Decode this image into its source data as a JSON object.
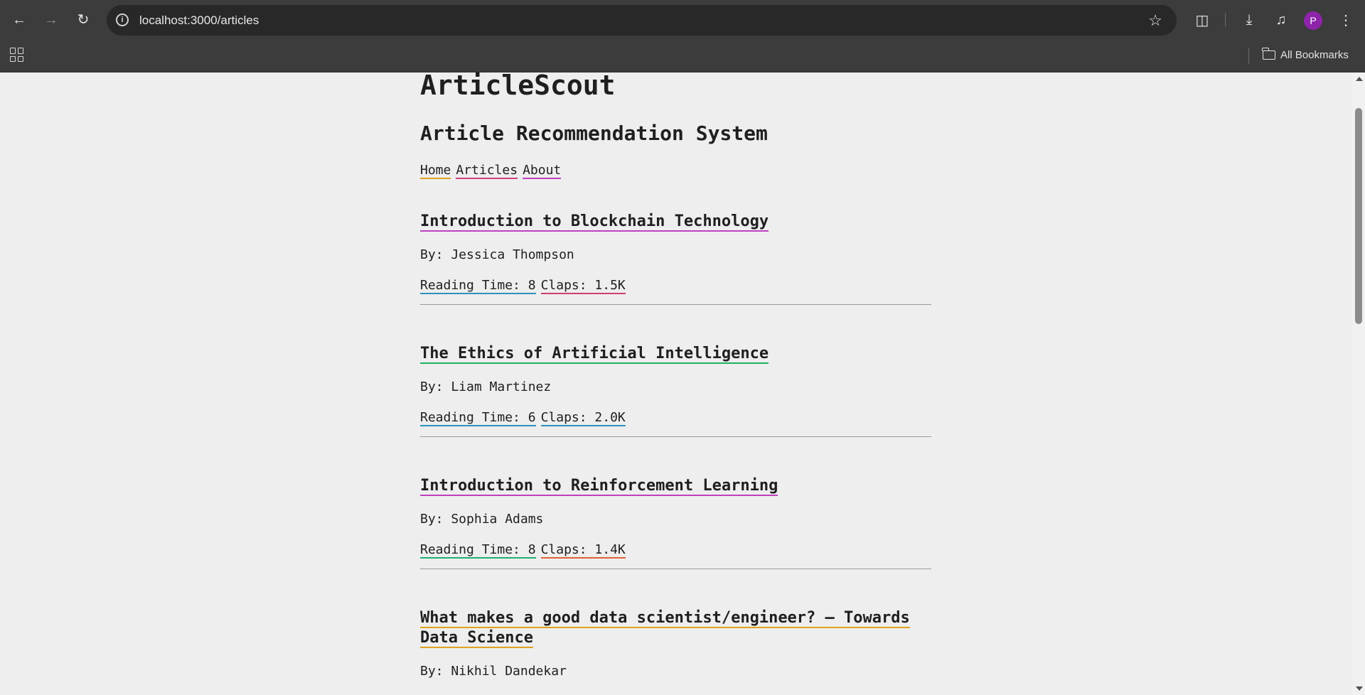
{
  "browser": {
    "url": "localhost:3000/articles",
    "bookmarks_label": "All Bookmarks",
    "profile_initial": "P"
  },
  "site": {
    "title": "ArticleScout",
    "subtitle": "Article Recommendation System",
    "nav": [
      {
        "label": "Home",
        "color": "#e0a020"
      },
      {
        "label": "Articles",
        "color": "#d04080"
      },
      {
        "label": "About",
        "color": "#c040c0"
      }
    ]
  },
  "articles": [
    {
      "title": "Introduction to Blockchain Technology",
      "author": "By: Jessica Thompson",
      "reading_time": "Reading Time: 8",
      "claps": "Claps: 1.5K",
      "title_color": "#c040c0",
      "rt_color": "#3090c0",
      "claps_color": "#d04070"
    },
    {
      "title": "The Ethics of Artificial Intelligence",
      "author": "By: Liam Martinez",
      "reading_time": "Reading Time: 6",
      "claps": "Claps: 2.0K",
      "title_color": "#20b060",
      "rt_color": "#3090c0",
      "claps_color": "#3090c0"
    },
    {
      "title": "Introduction to Reinforcement Learning",
      "author": "By: Sophia Adams",
      "reading_time": "Reading Time: 8",
      "claps": "Claps: 1.4K",
      "title_color": "#c040c0",
      "rt_color": "#20b070",
      "claps_color": "#e06030"
    },
    {
      "title": "What makes a good data scientist/engineer? – Towards Data Science",
      "author": "By: Nikhil Dandekar",
      "title_color": "#e0a020"
    }
  ]
}
